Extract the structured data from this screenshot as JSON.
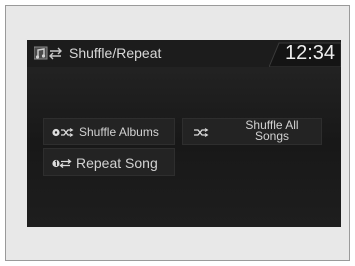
{
  "screen": {
    "title": "Shuffle/Repeat",
    "title_icon": "music-repeat-icon",
    "clock": "12:34"
  },
  "options": {
    "shuffle_albums": {
      "label": "Shuffle Albums",
      "icon": "shuffle-albums-icon"
    },
    "shuffle_all_songs": {
      "label": "Shuffle All Songs",
      "icon": "shuffle-icon"
    },
    "repeat_song": {
      "label": "Repeat Song",
      "icon": "repeat-one-icon"
    }
  },
  "colors": {
    "screen_background": "#1c1c1c",
    "text": "#d8d8d8",
    "button_background": "#232323"
  }
}
